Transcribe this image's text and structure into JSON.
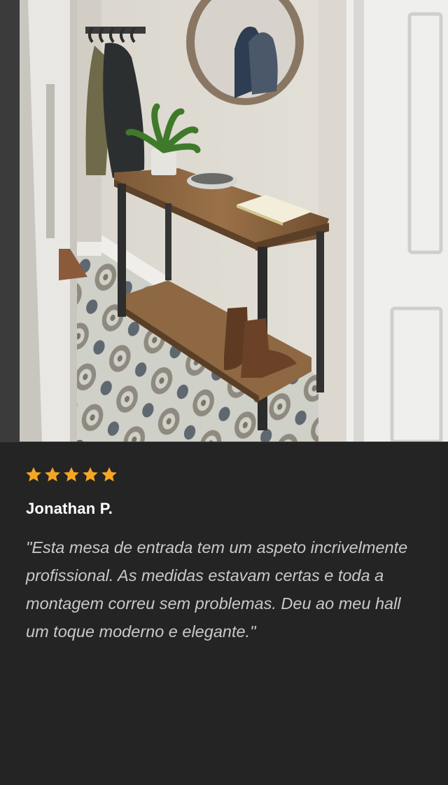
{
  "review": {
    "rating": 5,
    "rating_max": 5,
    "star_icon": "star-icon",
    "star_color": "#f5a623",
    "author": "Jonathan P.",
    "text": "\"Esta mesa de entrada tem um aspeto incrivelmente profissional. As medidas estavam certas e toda a montagem correu sem problemas. Deu ao meu hall um toque moderno e elegante.\""
  },
  "colors": {
    "background": "#242424",
    "author": "#ffffff",
    "quote": "#c9c9c9"
  }
}
